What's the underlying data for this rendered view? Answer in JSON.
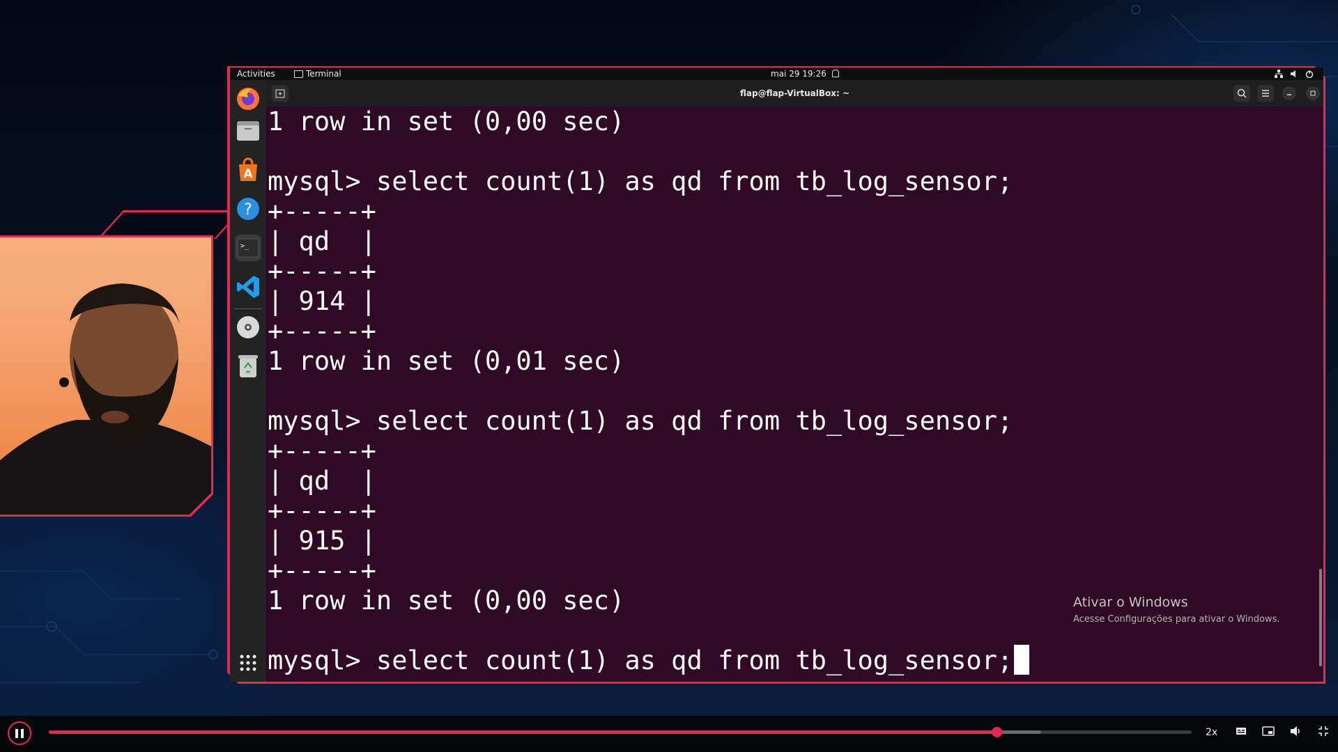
{
  "vm": {
    "topbar": {
      "activities": "Activities",
      "app": "Terminal",
      "clock": "mai 29  19:26"
    },
    "window_title": "flap@flap-VirtualBox: ~",
    "dock": [
      "firefox-icon",
      "files-icon",
      "software-center-icon",
      "help-icon",
      "terminal-icon",
      "vscode-icon",
      "disc-icon",
      "trash-icon",
      "apps-grid-icon"
    ]
  },
  "terminal": {
    "lines": [
      "1 row in set (0,00 sec)",
      "",
      "mysql> select count(1) as qd from tb_log_sensor;",
      "+-----+",
      "| qd  |",
      "+-----+",
      "| 914 |",
      "+-----+",
      "1 row in set (0,01 sec)",
      "",
      "mysql> select count(1) as qd from tb_log_sensor;",
      "+-----+",
      "| qd  |",
      "+-----+",
      "| 915 |",
      "+-----+",
      "1 row in set (0,00 sec)",
      "",
      "mysql> select count(1) as qd from tb_log_sensor;"
    ]
  },
  "watermark": {
    "title": "Ativar o Windows",
    "subtitle": "Acesse Configurações para ativar o Windows."
  },
  "player": {
    "speed": "2x",
    "progress": 0.829,
    "buffered": 0.868
  },
  "colors": {
    "accent": "#e8284f",
    "terminal_bg": "#300a24"
  }
}
